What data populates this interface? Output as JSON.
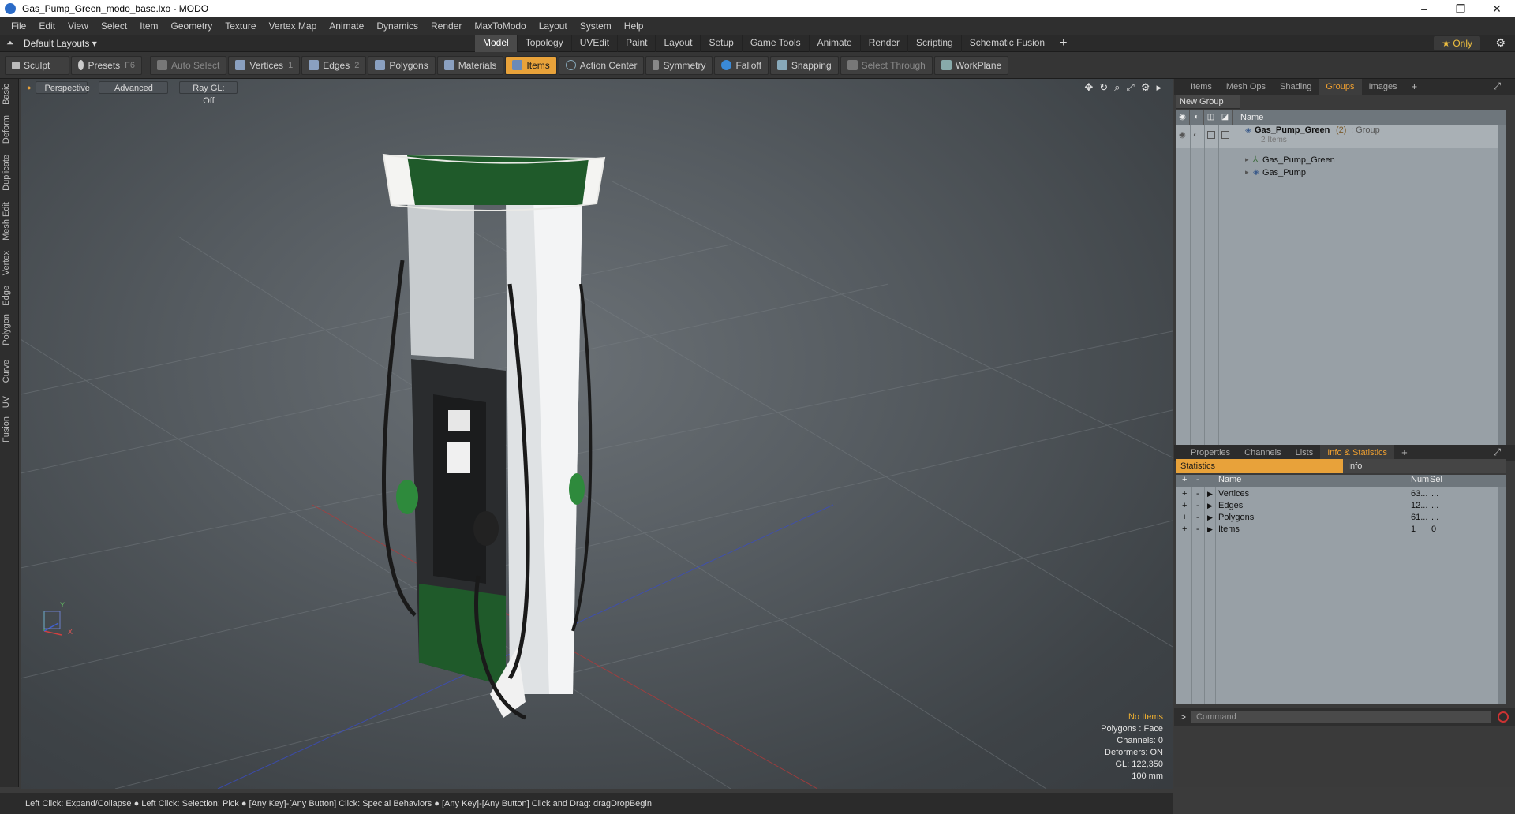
{
  "window": {
    "title": "Gas_Pump_Green_modo_base.lxo - MODO",
    "controls": [
      "–",
      "❐",
      "✕"
    ]
  },
  "menu": [
    "File",
    "Edit",
    "View",
    "Select",
    "Item",
    "Geometry",
    "Texture",
    "Vertex Map",
    "Animate",
    "Dynamics",
    "Render",
    "MaxToModo",
    "Layout",
    "System",
    "Help"
  ],
  "layout_bar": {
    "layout_select": "Default Layouts ▾",
    "tabs": [
      "Model",
      "Topology",
      "UVEdit",
      "Paint",
      "Layout",
      "Setup",
      "Game Tools",
      "Animate",
      "Render",
      "Scripting",
      "Schematic Fusion"
    ],
    "active_tab": "Model",
    "plus": "+",
    "only_label": "★  Only",
    "gear": "⚙"
  },
  "toolbar": {
    "sculpt": "Sculpt",
    "presets": "Presets",
    "presets_key": "F6",
    "auto_select": "Auto Select",
    "vertices": "Vertices",
    "vertices_num": "1",
    "edges": "Edges",
    "edges_num": "2",
    "polygons": "Polygons",
    "materials": "Materials",
    "items": "Items",
    "action_center": "Action Center",
    "symmetry": "Symmetry",
    "falloff": "Falloff",
    "snapping": "Snapping",
    "select_through": "Select Through",
    "workplane": "WorkPlane"
  },
  "left_tabs": [
    "Basic",
    "Deform",
    "Duplicate",
    "Mesh Edit",
    "Vertex",
    "Edge",
    "Polygon",
    "Curve",
    "UV",
    "Fusion"
  ],
  "viewport": {
    "perspective": "Perspective",
    "advanced": "Advanced",
    "raygl": "Ray GL: Off",
    "icons": [
      "✥",
      "↻",
      "⌕",
      "⤢",
      "⚙",
      "▸"
    ],
    "info": {
      "no_items": "No Items",
      "polygons": "Polygons : Face",
      "channels": "Channels: 0",
      "deformers": "Deformers: ON",
      "gl": "GL: 122,350",
      "scale": "100 mm"
    },
    "axis_y": "Y",
    "axis_x": "X"
  },
  "top_panel": {
    "tabs": [
      "Items",
      "Mesh Ops",
      "Shading",
      "Groups",
      "Images"
    ],
    "active_tab": "Groups",
    "plus": "+",
    "new_group": "New Group",
    "header_name": "Name",
    "group": {
      "name": "Gas_Pump_Green",
      "count": "(2)",
      "type": ": Group",
      "sub": "2 Items"
    },
    "children": [
      "Gas_Pump_Green",
      "Gas_Pump"
    ]
  },
  "bottom_panel": {
    "tabs": [
      "Properties",
      "Channels",
      "Lists",
      "Info & Statistics"
    ],
    "active_tab": "Info & Statistics",
    "plus": "+",
    "subtabs": [
      "Statistics",
      "Info"
    ],
    "headers": {
      "name": "Name",
      "num": "Num",
      "sel": "Sel"
    },
    "rows": [
      {
        "name": "Vertices",
        "num": "63...",
        "sel": "..."
      },
      {
        "name": "Edges",
        "num": "12...",
        "sel": "..."
      },
      {
        "name": "Polygons",
        "num": "61...",
        "sel": "..."
      },
      {
        "name": "Items",
        "num": "1",
        "sel": "0"
      }
    ]
  },
  "command": {
    "prompt": ">",
    "placeholder": "Command"
  },
  "status_bar": "Left Click: Expand/Collapse ● Left Click: Selection: Pick ● [Any Key]-[Any Button] Click: Special Behaviors ● [Any Key]-[Any Button] Click and Drag: dragDropBegin",
  "colors": {
    "accent": "#e8a23a",
    "tab_active": "#f0a030",
    "pump_green": "#1f5a2a"
  }
}
